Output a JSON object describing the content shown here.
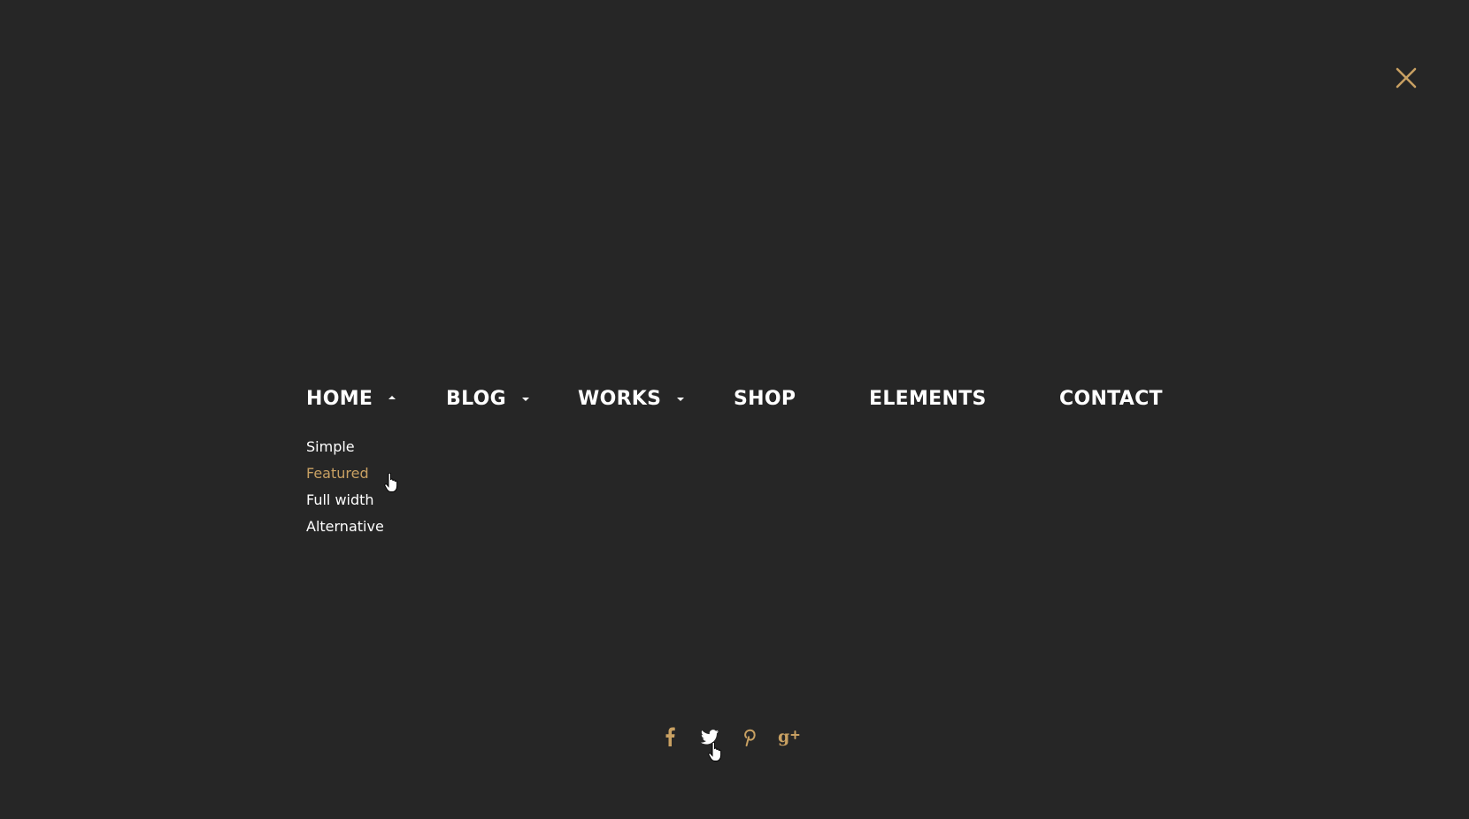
{
  "colors": {
    "background": "#262626",
    "text": "#ffffff",
    "accent": "#c8a062"
  },
  "close": {
    "icon": "close-icon"
  },
  "nav": {
    "items": [
      {
        "label": "HOME",
        "has_submenu": true,
        "expanded": true,
        "arrow": "caret-up-icon"
      },
      {
        "label": "BLOG",
        "has_submenu": true,
        "expanded": false,
        "arrow": "caret-down-icon"
      },
      {
        "label": "WORKS",
        "has_submenu": true,
        "expanded": false,
        "arrow": "caret-down-icon"
      },
      {
        "label": "SHOP",
        "has_submenu": false
      },
      {
        "label": "ELEMENTS",
        "has_submenu": false
      },
      {
        "label": "CONTACT",
        "has_submenu": false
      }
    ]
  },
  "submenu": {
    "parent": "HOME",
    "items": [
      {
        "label": "Simple",
        "active": false
      },
      {
        "label": "Featured",
        "active": true
      },
      {
        "label": "Full width",
        "active": false
      },
      {
        "label": "Alternative",
        "active": false
      }
    ]
  },
  "social": {
    "items": [
      {
        "icon": "facebook-icon",
        "hovered": false
      },
      {
        "icon": "twitter-icon",
        "hovered": true
      },
      {
        "icon": "pinterest-icon",
        "hovered": false
      },
      {
        "icon": "google-plus-icon",
        "hovered": false
      }
    ]
  }
}
